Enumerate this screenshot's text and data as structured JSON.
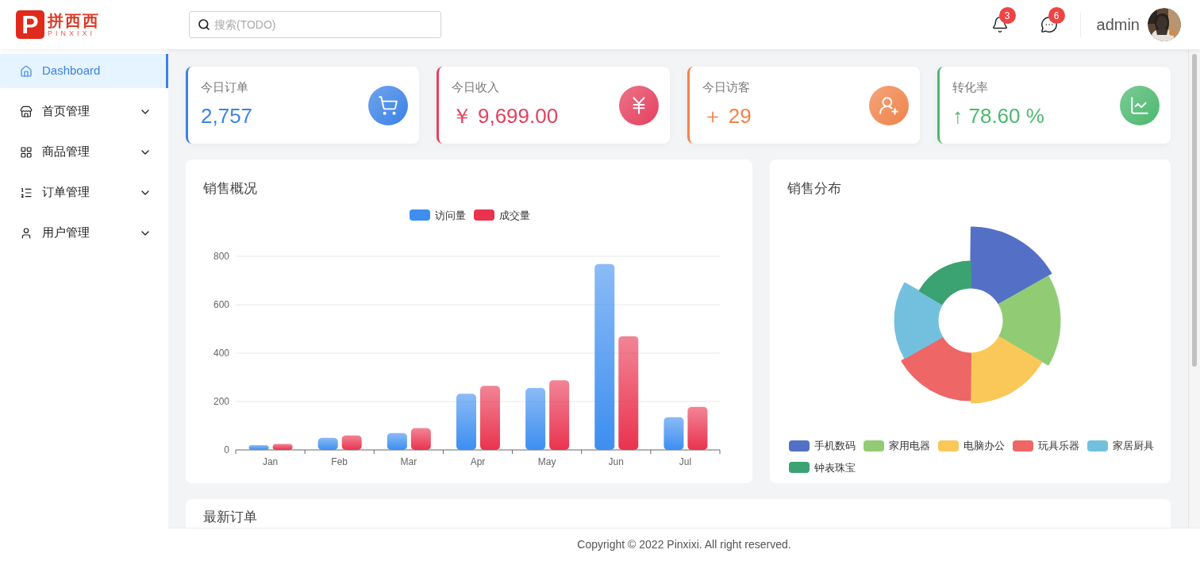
{
  "logo": {
    "mark": "P",
    "name": "拼西西",
    "subtitle": "PINXIXI"
  },
  "search": {
    "placeholder": "搜索(TODO)"
  },
  "header": {
    "notifications": {
      "badge": "3"
    },
    "messages": {
      "badge": "6"
    },
    "user": {
      "name": "admin"
    }
  },
  "sidebar": {
    "items": [
      {
        "label": "Dashboard",
        "kind": "link",
        "selected": true
      },
      {
        "label": "首页管理",
        "kind": "group",
        "selected": false,
        "expanded": false
      },
      {
        "label": "商品管理",
        "kind": "group",
        "selected": false,
        "expanded": false
      },
      {
        "label": "订单管理",
        "kind": "group",
        "selected": false,
        "expanded": false
      },
      {
        "label": "用户管理",
        "kind": "group",
        "selected": false,
        "expanded": false
      }
    ]
  },
  "stats": [
    {
      "label": "今日订单",
      "value": "2,757",
      "color": "#3b82e6"
    },
    {
      "label": "今日收入",
      "value": "￥ 9,699.00",
      "color": "#e5405e"
    },
    {
      "label": "今日访客",
      "value": "＋ 29",
      "color": "#f0834a"
    },
    {
      "label": "转化率",
      "value": "↑ 78.60 %",
      "color": "#4cb86e"
    }
  ],
  "sales_overview": {
    "title": "销售概况",
    "chart_data": {
      "type": "bar",
      "categories": [
        "Jan",
        "Feb",
        "Mar",
        "Apr",
        "May",
        "Jun",
        "Jul"
      ],
      "series": [
        {
          "name": "访问量",
          "color": "#3d8ef0",
          "values": [
            20,
            50,
            70,
            232,
            256,
            768,
            135
          ]
        },
        {
          "name": "成交量",
          "color": "#e9334f",
          "values": [
            25,
            60,
            90,
            265,
            288,
            470,
            178
          ]
        }
      ],
      "ylim": [
        0,
        800
      ],
      "yticks": [
        0,
        200,
        400,
        600,
        800
      ],
      "grid": true,
      "legend": "top"
    }
  },
  "sales_distribution": {
    "title": "销售分布",
    "legend": [
      {
        "label": "手机数码",
        "color": "#5470c6"
      },
      {
        "label": "家用电器",
        "color": "#91cc75"
      },
      {
        "label": "电脑办公",
        "color": "#fac858"
      },
      {
        "label": "玩具乐器",
        "color": "#ee6666"
      },
      {
        "label": "家居厨具",
        "color": "#73c0de"
      },
      {
        "label": "钟表珠宝",
        "color": "#3ba272"
      }
    ]
  },
  "latest_orders": {
    "title": "最新订单"
  },
  "footer": "Copyright © 2022 Pinxixi. All right reserved."
}
